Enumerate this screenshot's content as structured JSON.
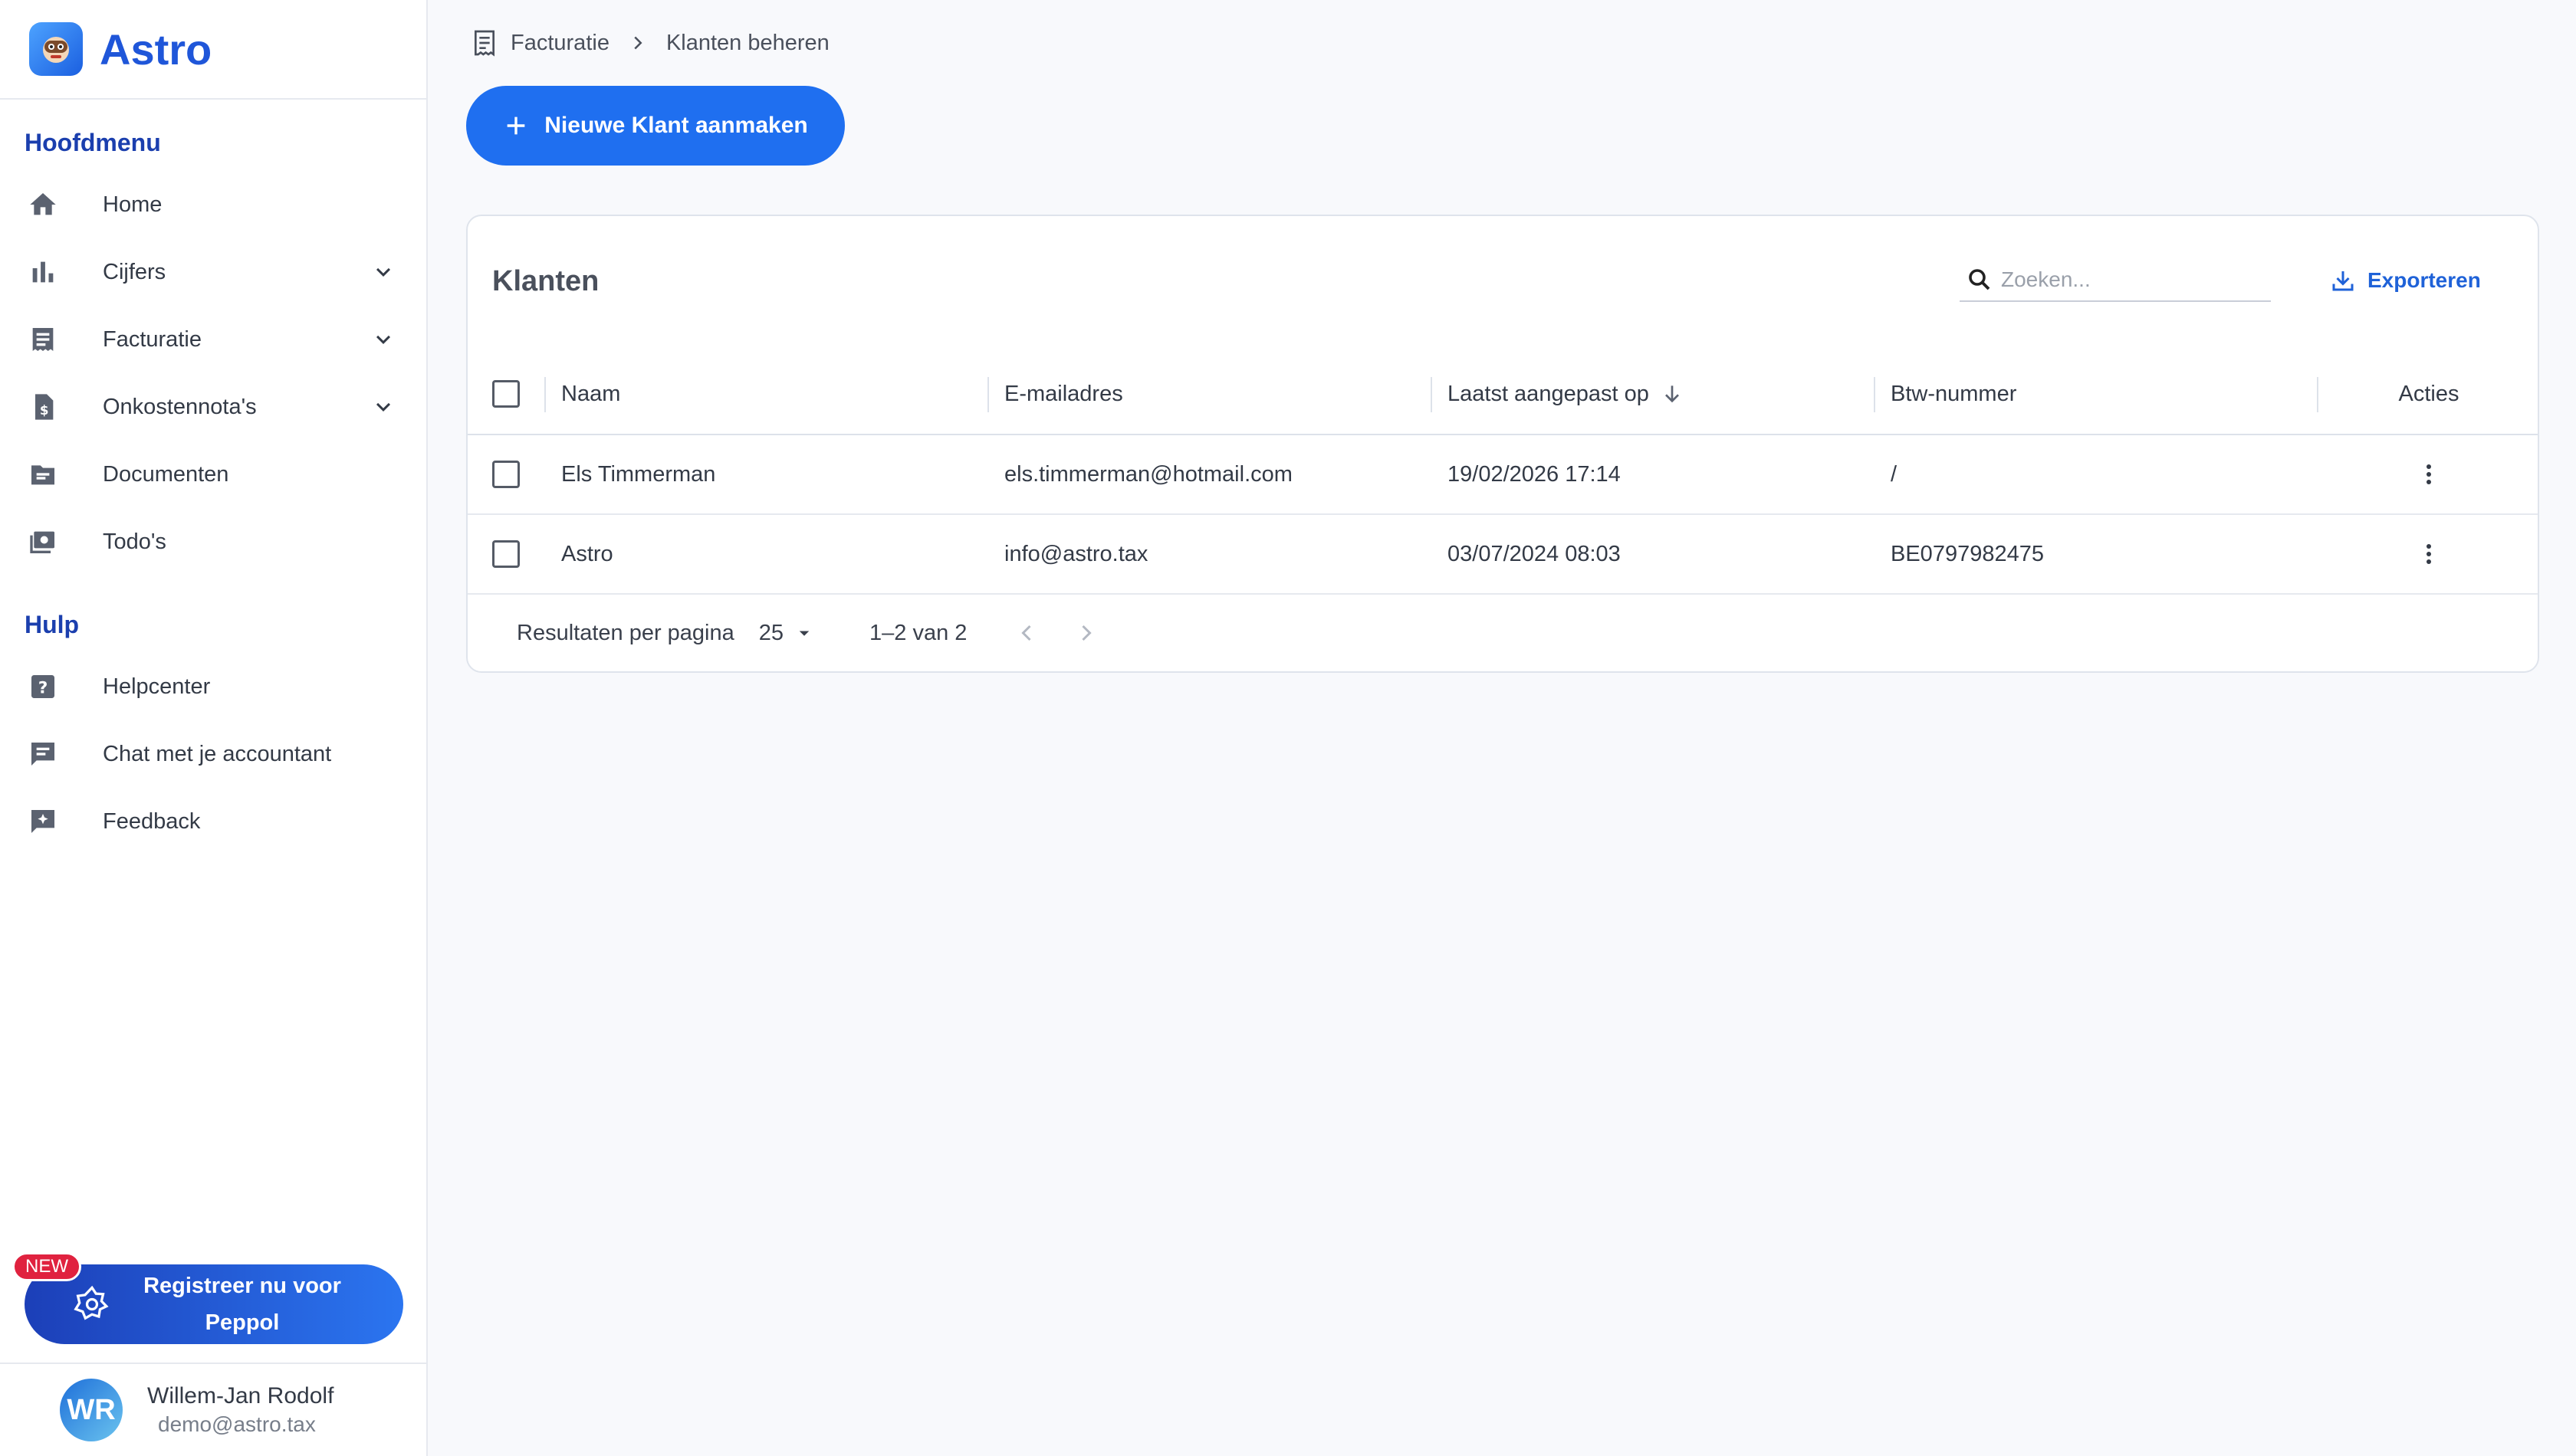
{
  "app": {
    "name": "Astro"
  },
  "sidebar": {
    "main_title": "Hoofdmenu",
    "main_items": [
      {
        "label": "Home",
        "icon": "home-icon"
      },
      {
        "label": "Cijfers",
        "icon": "bar-chart-icon"
      },
      {
        "label": "Facturatie",
        "icon": "receipt-icon"
      },
      {
        "label": "Onkostennota's",
        "icon": "expense-file-icon"
      },
      {
        "label": "Documenten",
        "icon": "folder-icon"
      },
      {
        "label": "Todo's",
        "icon": "todo-icon"
      }
    ],
    "help_title": "Hulp",
    "help_items": [
      {
        "label": "Helpcenter",
        "icon": "help-icon"
      },
      {
        "label": "Chat met je accountant",
        "icon": "chat-icon"
      },
      {
        "label": "Feedback",
        "icon": "feedback-icon"
      }
    ],
    "peppol": {
      "badge": "NEW",
      "label_line1": "Registreer nu voor",
      "label_line2": "Peppol"
    },
    "user": {
      "initials": "WR",
      "name": "Willem-Jan Rodolf",
      "email": "demo@astro.tax"
    }
  },
  "breadcrumb": {
    "parent": "Facturatie",
    "current": "Klanten beheren"
  },
  "new_button": {
    "label": "Nieuwe Klant aanmaken"
  },
  "card": {
    "title": "Klanten",
    "search_placeholder": "Zoeken...",
    "export_label": "Exporteren",
    "columns": {
      "name": "Naam",
      "email": "E-mailadres",
      "modified": "Laatst aangepast op",
      "vat": "Btw-nummer",
      "actions": "Acties"
    },
    "rows": [
      {
        "name": "Els Timmerman",
        "email": "els.timmerman@hotmail.com",
        "modified": "19/02/2026 17:14",
        "vat": "/"
      },
      {
        "name": "Astro",
        "email": "info@astro.tax",
        "modified": "03/07/2024 08:03",
        "vat": "BE0797982475"
      }
    ],
    "footer": {
      "per_page_label": "Resultaten per pagina",
      "per_page_value": "25",
      "range": "1–2 van 2"
    }
  },
  "colors": {
    "primary": "#1f6ff0",
    "brand": "#1f56d9",
    "sidebar_heading": "#1b3fae",
    "badge": "#e0223f"
  }
}
